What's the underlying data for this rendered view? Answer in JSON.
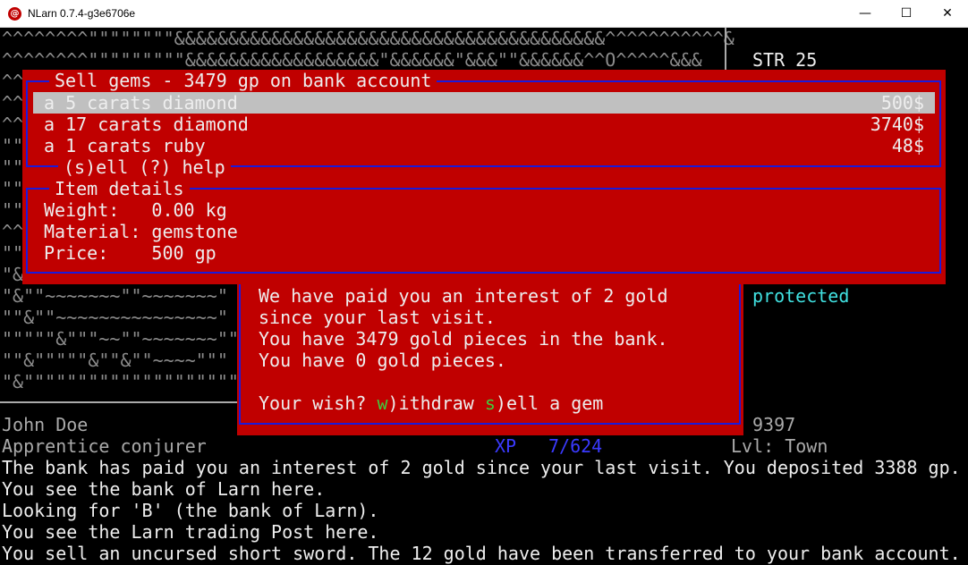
{
  "window": {
    "title": "NLarn 0.7.4-g3e6706e",
    "icon": "nlarn-icon",
    "minimize_glyph": "—",
    "maximize_glyph": "☐",
    "close_glyph": "✕"
  },
  "map_rows": [
    "^^^^^^^^\"\"\"\"\"\"\"\"&&&&&&&&&&&&&&&&&&&&&&&&&&&&&&&&&&&&&&&&^^^^^^^^^^^&",
    "^^^^^^^^\"\"\"\"\"\"\"\"\"&&&&&&&&&&&&&&&&&&\"&&&&&&\"&&&\"\"&&&&&&^^O^^^^^&&&",
    "^^",
    "^^",
    "^^",
    "\"\"",
    "\"\"",
    "\"\"",
    "\"\"",
    "^^",
    "\"\"",
    "\"&",
    "\"&\"\"~~~~~~~\"\"~~~~~~~\"",
    "\"\"&\"\"~~~~~~~~~~~~~~~\"",
    "\"\"\"\"\"&\"\"\"~~\"\"~~~~~~~\"\"",
    "\"\"&\"\"\"\"\"&\"\"&\"\"~~~~\"\"\"",
    "\"&\"\"\"\"\"\"\"\"\"\"\"\"\"\"\"\"\"\"\"\""
  ],
  "status": {
    "str": "STR 25",
    "protected": "protected",
    "gold": "9397",
    "name": "John Doe",
    "title": "Apprentice conjurer",
    "xp_label": "XP",
    "xp_value": "7/624",
    "level": "Lvl: Town"
  },
  "sell_dialog": {
    "title": "Sell gems - 3479 gp on bank account",
    "items": [
      {
        "name": "a 5 carats diamond",
        "price": "500$",
        "selected": true
      },
      {
        "name": "a 17 carats diamond",
        "price": "3740$",
        "selected": false
      },
      {
        "name": "a 1 carats ruby",
        "price": "48$",
        "selected": false
      }
    ],
    "footer": "(s)ell (?) help"
  },
  "details_dialog": {
    "title": "Item details",
    "weight": "Weight:   0.00 kg",
    "material": "Material: gemstone",
    "price": "Price:    500 gp"
  },
  "bank_dialog": {
    "lines": [
      "We have paid you an interest of 2 gold",
      "since your last visit.",
      "You have 3479 gold pieces in the bank.",
      "You have 0 gold pieces."
    ],
    "wish_prefix": "Your wish? ",
    "withdraw_key": "w",
    "withdraw_rest": ")ithdraw ",
    "sell_key": "s",
    "sell_rest": ")ell a gem"
  },
  "messages": [
    "The bank has paid you an interest of 2 gold since your last visit. You deposited 3388 gp.",
    "You see the bank of Larn here.",
    "Looking for 'B' (the bank of Larn).",
    "You see the Larn trading Post here.",
    "You sell an uncursed short sword. The 12 gold have been transferred to your bank account."
  ],
  "colors": {
    "panel": "#c00000",
    "frame": "#1a1adc",
    "highlight": "#c0c0c0",
    "accent_green": "#3ecc3e",
    "accent_cyan": "#40e0e0"
  }
}
